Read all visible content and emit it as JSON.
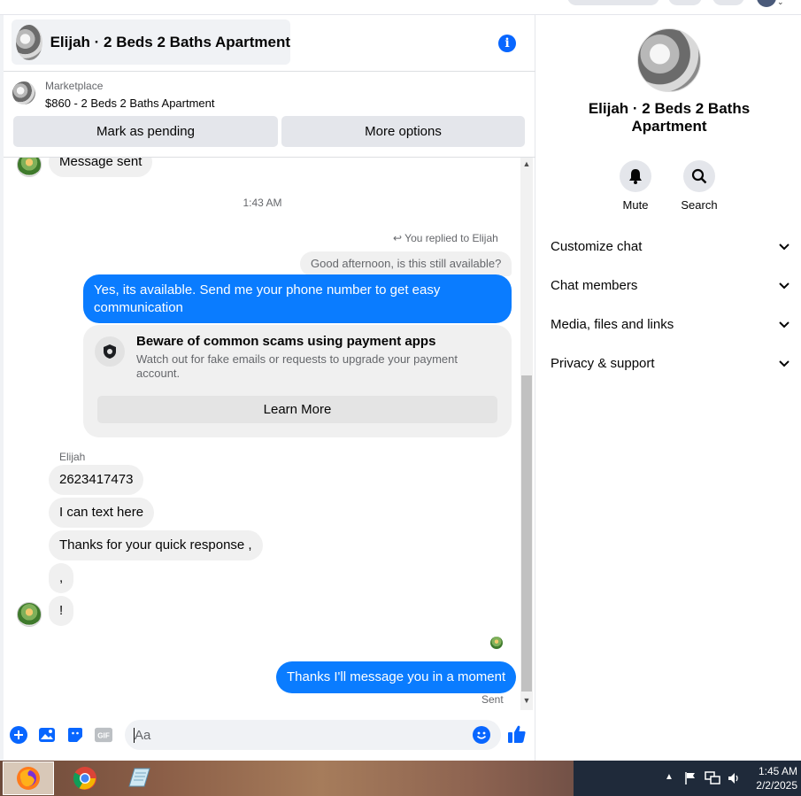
{
  "chat": {
    "title": "Elijah · 2 Beds 2 Baths Apartment",
    "info_icon": "info-icon"
  },
  "marketplace": {
    "label": "Marketplace",
    "listing": "$860 - 2 Beds 2 Baths Apartment",
    "mark_pending": "Mark as pending",
    "more_options": "More options"
  },
  "messages": {
    "partial_top": "Message sent",
    "time_separator": "1:43 AM",
    "replied_to": "You replied to Elijah",
    "quoted_text": "Good afternoon, is this still available?",
    "reply": "Yes, its available. Send me your phone number to get easy communication",
    "scam_title": "Beware of common scams using payment apps",
    "scam_text": "Watch out for fake emails or requests to upgrade your payment account.",
    "learn_more": "Learn More",
    "sender": "Elijah",
    "incoming": [
      "2623417473",
      "I can text here",
      "Thanks for your quick response ,",
      ",",
      "!"
    ],
    "outgoing_last": "Thanks I'll message you in a moment",
    "status": "Sent"
  },
  "composer": {
    "placeholder": "Aa"
  },
  "side": {
    "title": "Elijah · 2 Beds 2 Baths Apartment",
    "mute": "Mute",
    "search": "Search",
    "sections": [
      "Customize chat",
      "Chat members",
      "Media, files and links",
      "Privacy & support"
    ]
  },
  "taskbar": {
    "time": "1:45 AM",
    "date": "2/2/2025"
  },
  "colors": {
    "accent": "#0a7cff",
    "brand_blue": "#0866ff"
  }
}
